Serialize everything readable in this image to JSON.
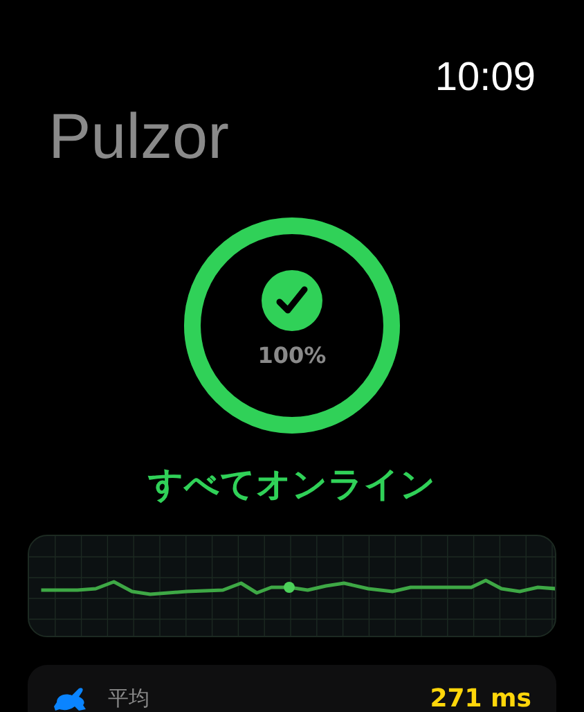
{
  "status_bar": {
    "time": "10:09"
  },
  "app": {
    "title": "Pulzor"
  },
  "status_ring": {
    "level": 1,
    "reading": "100%",
    "online": true
  },
  "status_text": "すべてオンライン",
  "stats": [
    {
      "kind": "speed",
      "label": "平均",
      "value": "271 ms"
    }
  ]
}
